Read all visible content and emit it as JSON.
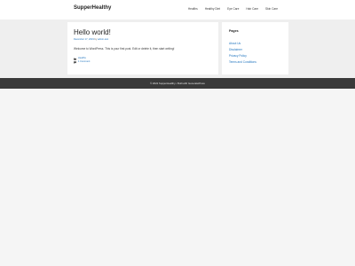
{
  "header": {
    "site_title": "SupperHealthy",
    "nav": [
      "Healths",
      "Healthy Diet",
      "Eye Care",
      "Hair Care",
      "Skin Care"
    ]
  },
  "post": {
    "title": "Hello world!",
    "meta_date": "December 17, 2019",
    "meta_by": "by",
    "meta_author": "admin-test",
    "body": "Welcome to WordPress. This is your first post. Edit or delete it, then start writing!",
    "category": "Healths",
    "comments": "1 Comment"
  },
  "sidebar": {
    "widget_title": "Pages",
    "links": [
      "About Us",
      "Disclaimer",
      "Privacy Policy",
      "Terms and Conditions"
    ]
  },
  "footer": {
    "text_prefix": "© 2022 SupperHealthy • Built with",
    "link": "GeneratePress"
  }
}
